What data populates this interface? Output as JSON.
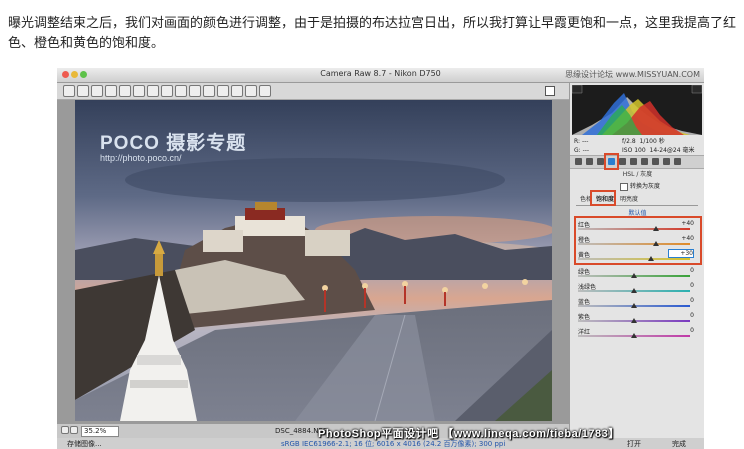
{
  "intro_text": "曝光调整结束之后，我们对画面的颜色进行调整，由于是拍摄的布达拉宫日出，所以我打算让早霞更饱和一点，这里我提高了红色、橙色和黄色的饱和度。",
  "window": {
    "title": "Camera Raw 8.7 - Nikon D750",
    "top_watermark": "思缘设计论坛 www.MISSYUAN.COM"
  },
  "photo": {
    "watermark_main": "POCO 摄影专题",
    "watermark_url": "http://photo.poco.cn/"
  },
  "status": {
    "zoom": "35.2%",
    "filename": "DSC_4884.NEF"
  },
  "bottom": {
    "save_label": "存储图像...",
    "workflow": "sRGB IEC61966-2.1; 16 位; 6016 x 4016 (24.2 百万像素); 300 ppi",
    "done_label": "完成",
    "open_label": "打开"
  },
  "panel": {
    "rgb_labels": [
      "R:",
      "G:",
      "B:"
    ],
    "rgb_values": [
      "---",
      "---",
      "---"
    ],
    "aperture": "f/2.8",
    "shutter": "1/100 秒",
    "iso": "ISO 100",
    "lens": "14-24@24 毫米",
    "section_title": "HSL / 灰度",
    "grayscale_label": "转换为灰度",
    "tabs": [
      "色相",
      "饱和度",
      "明亮度"
    ],
    "default_link": "默认值",
    "sliders": [
      {
        "label": "红色",
        "value": "+40",
        "track": "#d23a2a",
        "pos": 0.7
      },
      {
        "label": "橙色",
        "value": "+40",
        "track": "#e08a28",
        "pos": 0.7
      },
      {
        "label": "黄色",
        "value": "+30",
        "track": "#d6c22a",
        "pos": 0.65
      },
      {
        "label": "绿色",
        "value": "0",
        "track": "#3aa23a",
        "pos": 0.5
      },
      {
        "label": "浅绿色",
        "value": "0",
        "track": "#2ab0b0",
        "pos": 0.5
      },
      {
        "label": "蓝色",
        "value": "0",
        "track": "#2a5ad0",
        "pos": 0.5
      },
      {
        "label": "紫色",
        "value": "0",
        "track": "#7a3ac0",
        "pos": 0.5
      },
      {
        "label": "洋红",
        "value": "0",
        "track": "#c03aa8",
        "pos": 0.5
      }
    ]
  },
  "banner": "PhotoShop平面设计吧 【www.lineqa.com/tieba/1783】",
  "colors": {
    "highlight": "#d94a2a"
  }
}
